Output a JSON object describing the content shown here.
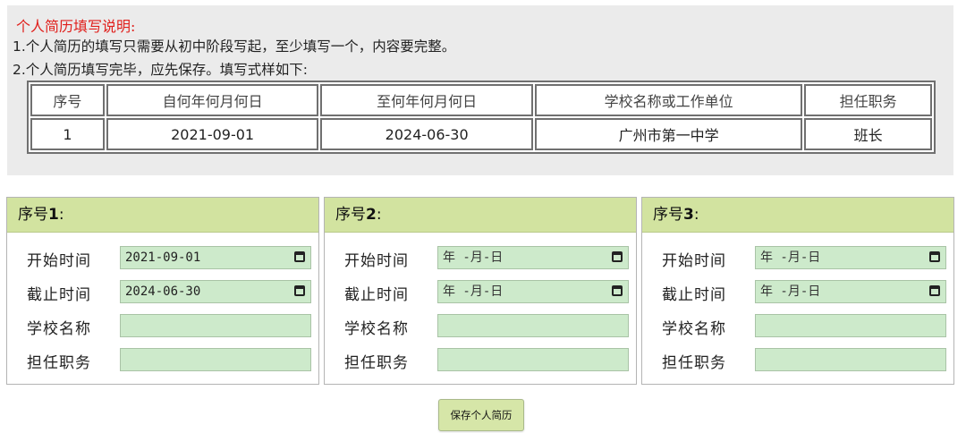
{
  "instructions": {
    "title": "个人简历填写说明:",
    "line1": "1.个人简历的填写只需要从初中阶段写起，至少填写一个，内容要完整。",
    "line2": "2.个人简历填写完毕，应先保存。填写式样如下:"
  },
  "example_table": {
    "headers": [
      "序号",
      "自何年何月何日",
      "至何年何月何日",
      "学校名称或工作单位",
      "担任职务"
    ],
    "row": [
      "1",
      "2021-09-01",
      "2024-06-30",
      "广州市第一中学",
      "班长"
    ]
  },
  "labels": {
    "start": "开始时间",
    "end": "截止时间",
    "school": "学校名称",
    "position": "担任职务"
  },
  "panels": [
    {
      "prefix": "序号",
      "num": "1",
      "suffix": ":",
      "start_value": "2021-09-01",
      "end_value": "2024-06-30",
      "school": "",
      "position": ""
    },
    {
      "prefix": "序号",
      "num": "2",
      "suffix": ":",
      "start_value": "年 -月-日",
      "end_value": "年 -月-日",
      "school": "",
      "position": ""
    },
    {
      "prefix": "序号",
      "num": "3",
      "suffix": ":",
      "start_value": "年 -月-日",
      "end_value": "年 -月-日",
      "school": "",
      "position": ""
    }
  ],
  "save_button": "保存个人简历"
}
